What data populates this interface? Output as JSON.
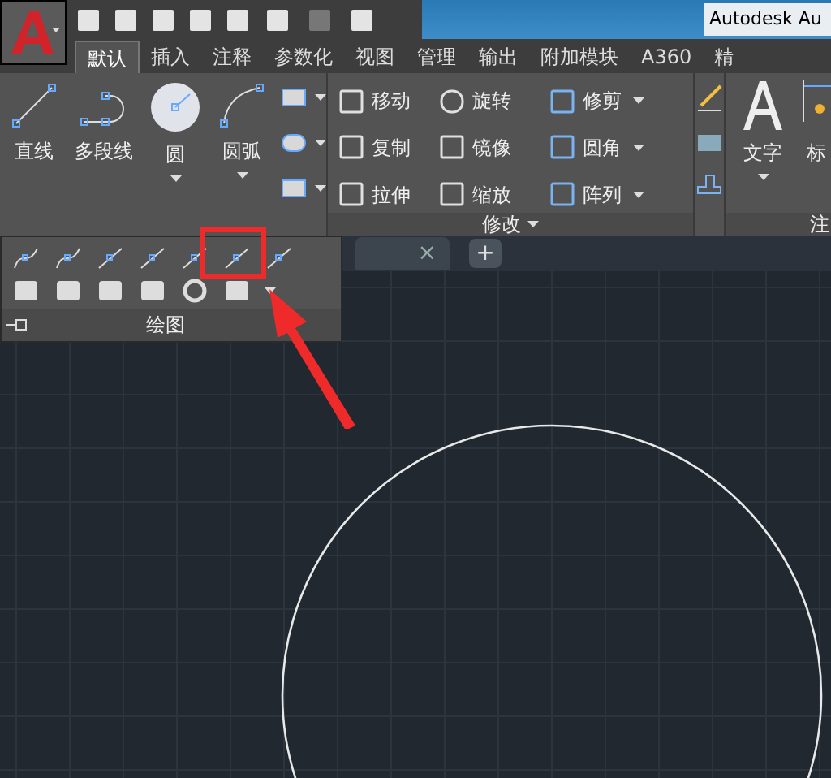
{
  "title_bar": {
    "title": "Autodesk Au"
  },
  "tabs": [
    {
      "label": "默认",
      "selected": true
    },
    {
      "label": "插入",
      "selected": false
    },
    {
      "label": "注释",
      "selected": false
    },
    {
      "label": "参数化",
      "selected": false
    },
    {
      "label": "视图",
      "selected": false
    },
    {
      "label": "管理",
      "selected": false
    },
    {
      "label": "输出",
      "selected": false
    },
    {
      "label": "附加模块",
      "selected": false
    },
    {
      "label": "A360",
      "selected": false
    },
    {
      "label": "精",
      "selected": false
    }
  ],
  "draw_panel": {
    "tools": [
      "直线",
      "多段线",
      "圆",
      "圆弧"
    ],
    "title": "绘图"
  },
  "modify_panel": {
    "title": "修改",
    "tools": [
      {
        "label": "移动",
        "dropdown": false
      },
      {
        "label": "旋转",
        "dropdown": false
      },
      {
        "label": "修剪",
        "dropdown": true
      },
      {
        "label": "复制",
        "dropdown": false
      },
      {
        "label": "镜像",
        "dropdown": false
      },
      {
        "label": "圆角",
        "dropdown": true
      },
      {
        "label": "拉伸",
        "dropdown": false
      },
      {
        "label": "缩放",
        "dropdown": false
      },
      {
        "label": "阵列",
        "dropdown": true
      }
    ]
  },
  "annotation_panel": {
    "title": "注",
    "tools": [
      "文字",
      "标"
    ]
  },
  "file_tab_bar": {
    "close": "×",
    "add": "+"
  }
}
